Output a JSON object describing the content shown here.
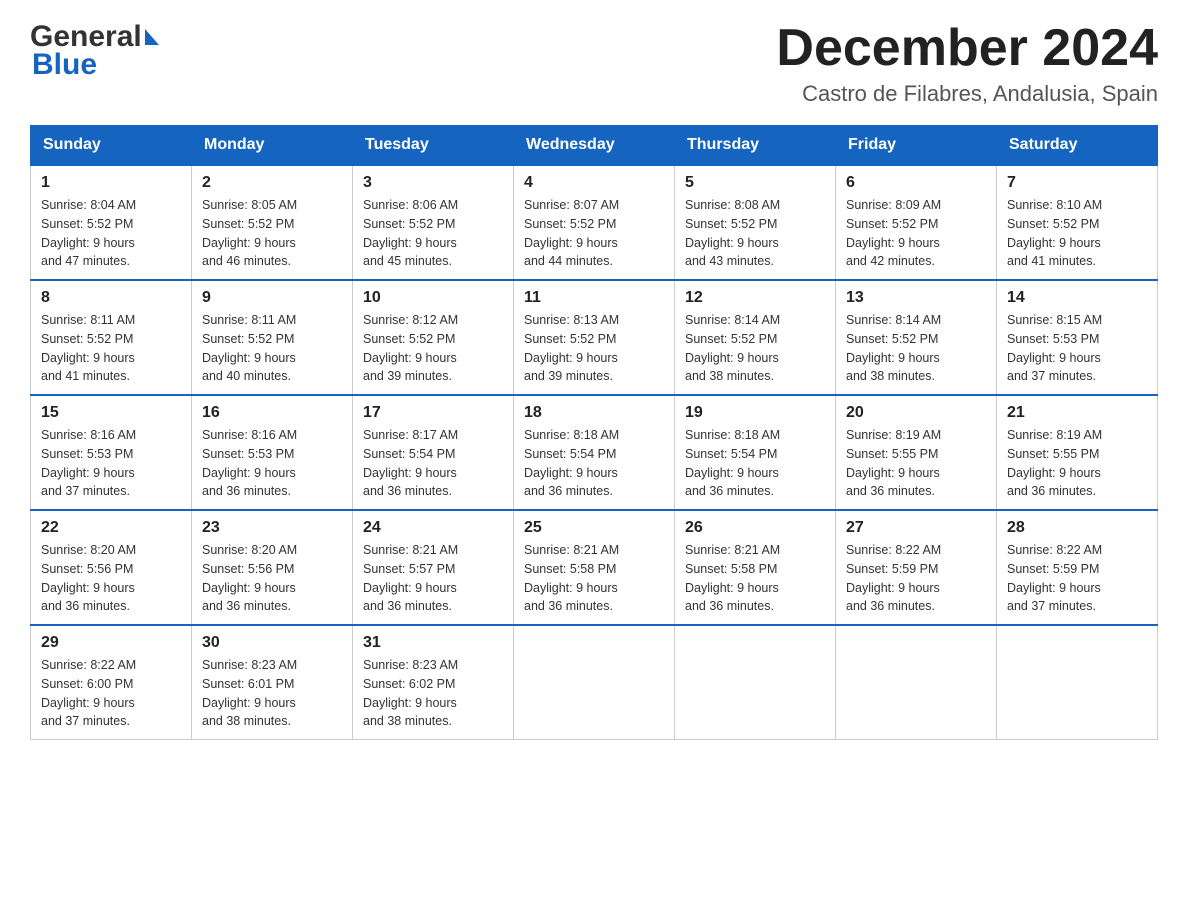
{
  "logo": {
    "line1": "General",
    "line2": "Blue"
  },
  "title": "December 2024",
  "subtitle": "Castro de Filabres, Andalusia, Spain",
  "days": {
    "headers": [
      "Sunday",
      "Monday",
      "Tuesday",
      "Wednesday",
      "Thursday",
      "Friday",
      "Saturday"
    ]
  },
  "weeks": [
    {
      "days": [
        {
          "num": "1",
          "info": "Sunrise: 8:04 AM\nSunset: 5:52 PM\nDaylight: 9 hours\nand 47 minutes."
        },
        {
          "num": "2",
          "info": "Sunrise: 8:05 AM\nSunset: 5:52 PM\nDaylight: 9 hours\nand 46 minutes."
        },
        {
          "num": "3",
          "info": "Sunrise: 8:06 AM\nSunset: 5:52 PM\nDaylight: 9 hours\nand 45 minutes."
        },
        {
          "num": "4",
          "info": "Sunrise: 8:07 AM\nSunset: 5:52 PM\nDaylight: 9 hours\nand 44 minutes."
        },
        {
          "num": "5",
          "info": "Sunrise: 8:08 AM\nSunset: 5:52 PM\nDaylight: 9 hours\nand 43 minutes."
        },
        {
          "num": "6",
          "info": "Sunrise: 8:09 AM\nSunset: 5:52 PM\nDaylight: 9 hours\nand 42 minutes."
        },
        {
          "num": "7",
          "info": "Sunrise: 8:10 AM\nSunset: 5:52 PM\nDaylight: 9 hours\nand 41 minutes."
        }
      ]
    },
    {
      "days": [
        {
          "num": "8",
          "info": "Sunrise: 8:11 AM\nSunset: 5:52 PM\nDaylight: 9 hours\nand 41 minutes."
        },
        {
          "num": "9",
          "info": "Sunrise: 8:11 AM\nSunset: 5:52 PM\nDaylight: 9 hours\nand 40 minutes."
        },
        {
          "num": "10",
          "info": "Sunrise: 8:12 AM\nSunset: 5:52 PM\nDaylight: 9 hours\nand 39 minutes."
        },
        {
          "num": "11",
          "info": "Sunrise: 8:13 AM\nSunset: 5:52 PM\nDaylight: 9 hours\nand 39 minutes."
        },
        {
          "num": "12",
          "info": "Sunrise: 8:14 AM\nSunset: 5:52 PM\nDaylight: 9 hours\nand 38 minutes."
        },
        {
          "num": "13",
          "info": "Sunrise: 8:14 AM\nSunset: 5:52 PM\nDaylight: 9 hours\nand 38 minutes."
        },
        {
          "num": "14",
          "info": "Sunrise: 8:15 AM\nSunset: 5:53 PM\nDaylight: 9 hours\nand 37 minutes."
        }
      ]
    },
    {
      "days": [
        {
          "num": "15",
          "info": "Sunrise: 8:16 AM\nSunset: 5:53 PM\nDaylight: 9 hours\nand 37 minutes."
        },
        {
          "num": "16",
          "info": "Sunrise: 8:16 AM\nSunset: 5:53 PM\nDaylight: 9 hours\nand 36 minutes."
        },
        {
          "num": "17",
          "info": "Sunrise: 8:17 AM\nSunset: 5:54 PM\nDaylight: 9 hours\nand 36 minutes."
        },
        {
          "num": "18",
          "info": "Sunrise: 8:18 AM\nSunset: 5:54 PM\nDaylight: 9 hours\nand 36 minutes."
        },
        {
          "num": "19",
          "info": "Sunrise: 8:18 AM\nSunset: 5:54 PM\nDaylight: 9 hours\nand 36 minutes."
        },
        {
          "num": "20",
          "info": "Sunrise: 8:19 AM\nSunset: 5:55 PM\nDaylight: 9 hours\nand 36 minutes."
        },
        {
          "num": "21",
          "info": "Sunrise: 8:19 AM\nSunset: 5:55 PM\nDaylight: 9 hours\nand 36 minutes."
        }
      ]
    },
    {
      "days": [
        {
          "num": "22",
          "info": "Sunrise: 8:20 AM\nSunset: 5:56 PM\nDaylight: 9 hours\nand 36 minutes."
        },
        {
          "num": "23",
          "info": "Sunrise: 8:20 AM\nSunset: 5:56 PM\nDaylight: 9 hours\nand 36 minutes."
        },
        {
          "num": "24",
          "info": "Sunrise: 8:21 AM\nSunset: 5:57 PM\nDaylight: 9 hours\nand 36 minutes."
        },
        {
          "num": "25",
          "info": "Sunrise: 8:21 AM\nSunset: 5:58 PM\nDaylight: 9 hours\nand 36 minutes."
        },
        {
          "num": "26",
          "info": "Sunrise: 8:21 AM\nSunset: 5:58 PM\nDaylight: 9 hours\nand 36 minutes."
        },
        {
          "num": "27",
          "info": "Sunrise: 8:22 AM\nSunset: 5:59 PM\nDaylight: 9 hours\nand 36 minutes."
        },
        {
          "num": "28",
          "info": "Sunrise: 8:22 AM\nSunset: 5:59 PM\nDaylight: 9 hours\nand 37 minutes."
        }
      ]
    },
    {
      "days": [
        {
          "num": "29",
          "info": "Sunrise: 8:22 AM\nSunset: 6:00 PM\nDaylight: 9 hours\nand 37 minutes."
        },
        {
          "num": "30",
          "info": "Sunrise: 8:23 AM\nSunset: 6:01 PM\nDaylight: 9 hours\nand 38 minutes."
        },
        {
          "num": "31",
          "info": "Sunrise: 8:23 AM\nSunset: 6:02 PM\nDaylight: 9 hours\nand 38 minutes."
        },
        null,
        null,
        null,
        null
      ]
    }
  ]
}
